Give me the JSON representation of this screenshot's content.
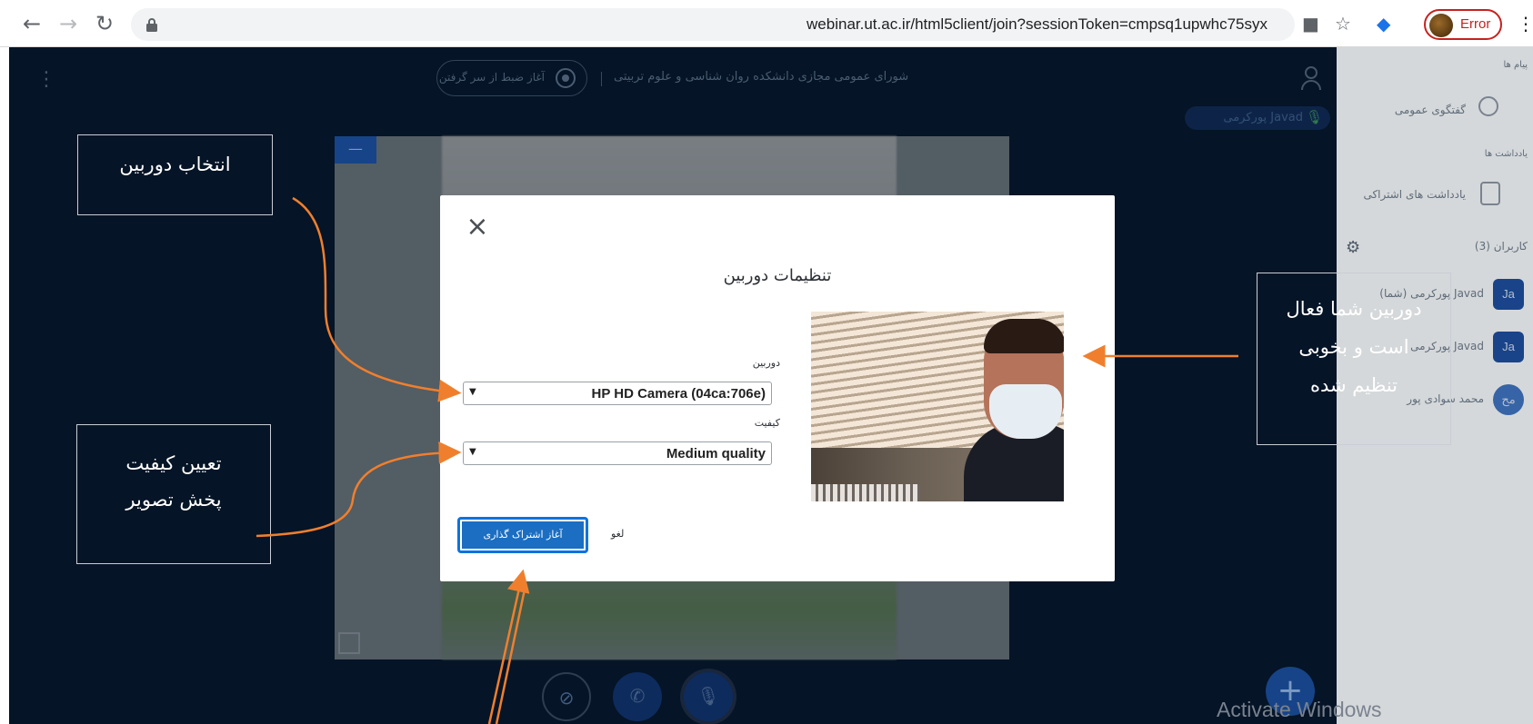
{
  "browser": {
    "url": "webinar.ut.ac.ir/html5client/join?sessionToken=cmpsq1upwhc75syx",
    "profile_status": "Error",
    "back_icon": "back-arrow-icon",
    "forward_icon": "forward-arrow-icon",
    "reload_icon": "reload-icon",
    "lock_icon": "lock-icon"
  },
  "header": {
    "meeting_title": "شورای عمومی مجازی دانشکده روان شناسی و علوم تربیتی",
    "record_label": "آغاز ضبط از سر گرفتن",
    "talker": "Javad پورکرمی"
  },
  "sidebar": {
    "messages_heading": "پیام ها",
    "public_chat": "گفتگوی عمومی",
    "notes_heading": "یادداشت ها",
    "shared_notes": "یادداشت های اشتراکی",
    "users_heading": "کاربران (3)",
    "users": [
      {
        "initials": "Ja",
        "name": "Javad پورکرمی (شما)"
      },
      {
        "initials": "Ja",
        "name": "Javad پورکرمی"
      },
      {
        "initials": "مح",
        "name": "محمد سوادی پور"
      }
    ]
  },
  "modal": {
    "title": "تنظیمات دوربین",
    "camera_label": "دوربین",
    "camera_value": "HP HD Camera (04ca:706e)",
    "quality_label": "کیفیت",
    "quality_value": "Medium quality",
    "start_button": "آغاز اشتراک گذاری",
    "cancel": "لغو"
  },
  "annotations": {
    "select_camera": "انتخاب دوربین",
    "quality_line1": "تعیین کیفیت",
    "quality_line2": "پخش تصویر",
    "active_line1": "دوربین شما فعال",
    "active_line2": "است و بخوبی",
    "active_line3": "تنظیم شده",
    "accent_color": "#f07f2d"
  },
  "watermark": "Activate Windows"
}
